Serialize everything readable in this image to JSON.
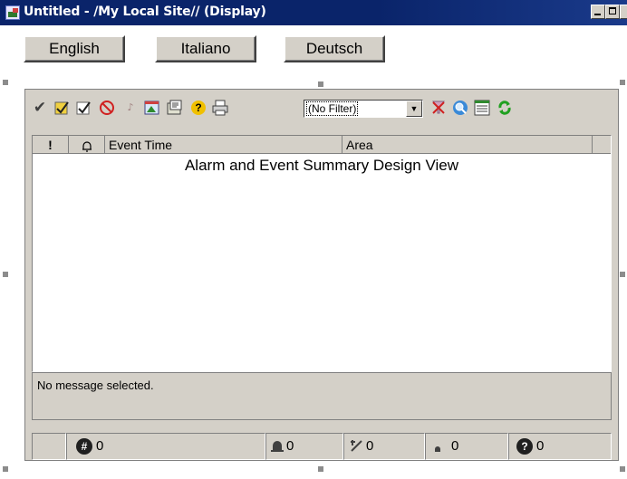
{
  "window": {
    "title": "Untitled - /My Local Site// (Display)"
  },
  "language_buttons": [
    {
      "label": "English"
    },
    {
      "label": "Italiano"
    },
    {
      "label": "Deutsch"
    }
  ],
  "toolbar": {
    "icons": [
      "acknowledge-check-icon",
      "acknowledge-visible-icon",
      "acknowledge-page-icon",
      "silence-icon",
      "reset-icon",
      "freeze-icon",
      "properties-icon",
      "help-icon",
      "print-icon",
      "clear-filter-icon",
      "find-icon",
      "details-icon",
      "refresh-icon"
    ],
    "filter_value": "(No Filter)"
  },
  "grid": {
    "columns": [
      "!",
      "",
      "Event Time",
      "Area"
    ],
    "design_view_text": "Alarm and Event Summary Design View"
  },
  "message": {
    "text": "No message selected."
  },
  "status": {
    "total": "0",
    "active": "0",
    "unacked": "0",
    "shelved": "0",
    "unknown": "0"
  },
  "colors": {
    "titlebar": "#0a246a",
    "control_face": "#d4d0c8"
  }
}
